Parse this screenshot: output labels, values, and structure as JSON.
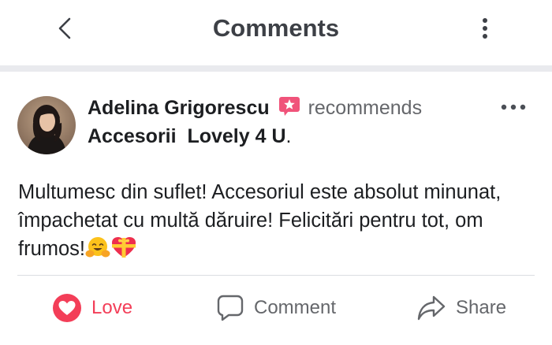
{
  "header": {
    "title": "Comments",
    "back_icon": "chevron-left-icon",
    "menu_icon": "vertical-dots-icon"
  },
  "post": {
    "author": "Adelina Grigorescu",
    "recommend_icon": "recommend-star-icon",
    "verb": "recommends",
    "page_name": "Accesorii  Lovely 4 U",
    "page_suffix": ".",
    "text": "Multumesc din suflet! Accesoriul este absolut minunat, împachetat cu multă dăruire! Felicitări pentru tot, om frumos!",
    "emojis": [
      "hugging-face-emoji",
      "heart-with-ribbon-emoji"
    ]
  },
  "actions": {
    "love": "Love",
    "comment": "Comment",
    "share": "Share"
  },
  "colors": {
    "love_red": "#f33e58",
    "recommend_pink": "#f0537a",
    "text_dark": "#1c1e21",
    "text_gray": "#65676b"
  }
}
